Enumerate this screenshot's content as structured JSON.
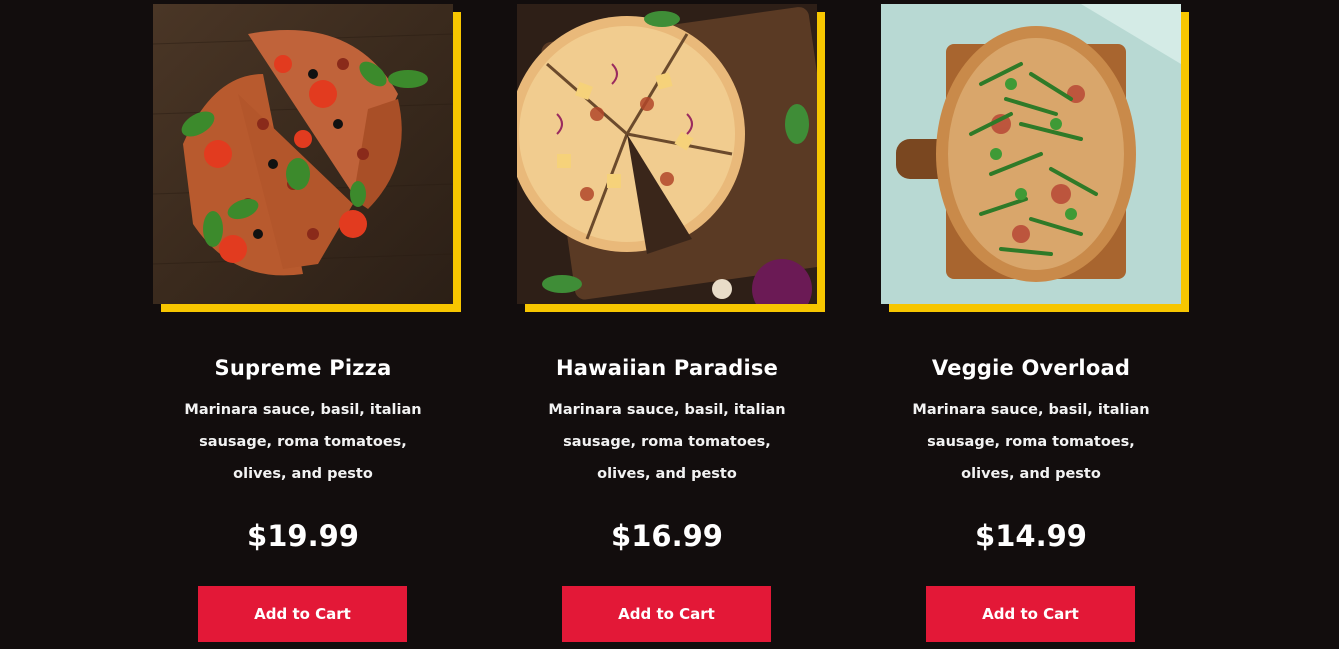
{
  "colors": {
    "background": "#120d0d",
    "accent_frame": "#f7c600",
    "button": "#e31837",
    "text": "#ffffff"
  },
  "products": [
    {
      "image_icon": "supreme-pizza-photo",
      "name": "Supreme Pizza",
      "description": "Marinara sauce, basil, italian sausage, roma tomatoes, olives, and pesto",
      "price": "$19.99",
      "button_label": "Add to Cart"
    },
    {
      "image_icon": "hawaiian-pizza-photo",
      "name": "Hawaiian Paradise",
      "description": "Marinara sauce, basil, italian sausage, roma tomatoes, olives, and pesto",
      "price": "$16.99",
      "button_label": "Add to Cart"
    },
    {
      "image_icon": "veggie-pizza-photo",
      "name": "Veggie Overload",
      "description": "Marinara sauce, basil, italian sausage, roma tomatoes, olives, and pesto",
      "price": "$14.99",
      "button_label": "Add to Cart"
    }
  ]
}
